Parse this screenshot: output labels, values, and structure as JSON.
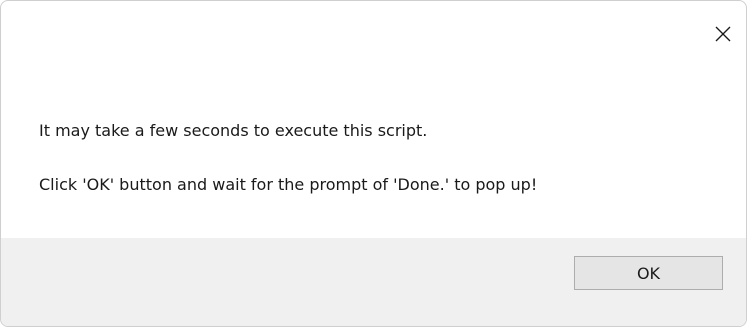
{
  "dialog": {
    "close_icon": "close-icon",
    "message_lines": [
      "It may take a few seconds to execute this script.",
      "Click 'OK' button and wait for the prompt of 'Done.' to pop up!"
    ],
    "ok_label": "OK"
  }
}
